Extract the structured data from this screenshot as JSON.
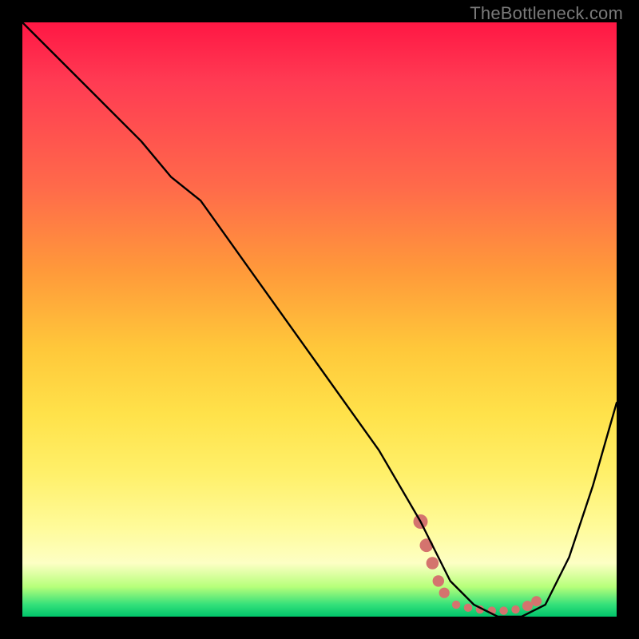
{
  "branding": "TheBottleneck.com",
  "chart_data": {
    "type": "line",
    "title": "",
    "xlabel": "",
    "ylabel": "",
    "xlim": [
      0,
      100
    ],
    "ylim": [
      0,
      100
    ],
    "series": [
      {
        "name": "curve",
        "x": [
          0,
          10,
          20,
          25,
          30,
          40,
          50,
          60,
          67,
          72,
          76,
          80,
          84,
          88,
          92,
          96,
          100
        ],
        "y": [
          100,
          90,
          80,
          74,
          70,
          56,
          42,
          28,
          16,
          6,
          2,
          0,
          0,
          2,
          10,
          22,
          36
        ]
      }
    ],
    "markers": {
      "name": "bottleneck-cluster",
      "color": "#d4736e",
      "points": [
        {
          "x": 67,
          "y": 16
        },
        {
          "x": 68,
          "y": 12
        },
        {
          "x": 69,
          "y": 9
        },
        {
          "x": 70,
          "y": 6
        },
        {
          "x": 71,
          "y": 4
        },
        {
          "x": 73,
          "y": 2
        },
        {
          "x": 75,
          "y": 1.5
        },
        {
          "x": 77,
          "y": 1.2
        },
        {
          "x": 79,
          "y": 1
        },
        {
          "x": 81,
          "y": 1
        },
        {
          "x": 83,
          "y": 1.2
        },
        {
          "x": 85,
          "y": 1.8
        },
        {
          "x": 86.5,
          "y": 2.6
        }
      ]
    },
    "background_gradient_stops": [
      {
        "pos": 0,
        "color": "#ff1744"
      },
      {
        "pos": 10,
        "color": "#ff3b53"
      },
      {
        "pos": 28,
        "color": "#ff6b4a"
      },
      {
        "pos": 42,
        "color": "#ff9a3a"
      },
      {
        "pos": 55,
        "color": "#ffc83a"
      },
      {
        "pos": 66,
        "color": "#ffe24a"
      },
      {
        "pos": 76,
        "color": "#fff06a"
      },
      {
        "pos": 85,
        "color": "#fffb9a"
      },
      {
        "pos": 91,
        "color": "#fdffc4"
      },
      {
        "pos": 95,
        "color": "#b6ff7a"
      },
      {
        "pos": 98,
        "color": "#33e07a"
      },
      {
        "pos": 100,
        "color": "#00c46a"
      }
    ]
  }
}
